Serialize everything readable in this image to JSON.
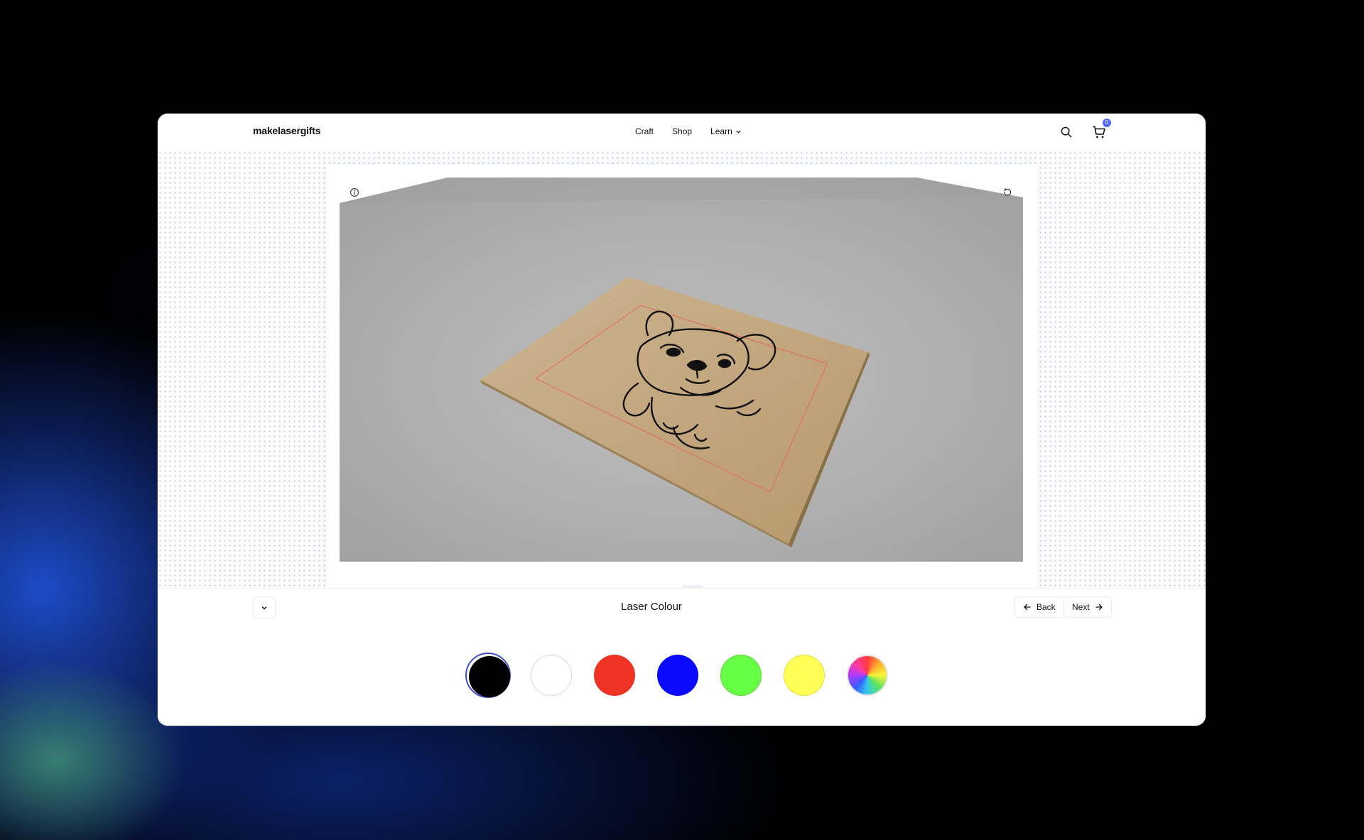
{
  "app": {
    "logo": "makelasergifts",
    "nav": [
      {
        "label": "Craft"
      },
      {
        "label": "Shop"
      },
      {
        "label": "Learn",
        "has_dropdown": true
      }
    ],
    "cart_count": "0"
  },
  "viewer": {
    "info_icon": "info-icon",
    "reset_icon": "rotate-ccw-icon",
    "board_material": "wood",
    "engraving": "french-bulldog-sketch"
  },
  "step": {
    "title": "Laser Colour",
    "back_label": "Back",
    "next_label": "Next"
  },
  "laser_colours": [
    {
      "name": "black",
      "color": "#000000",
      "selected": true
    },
    {
      "name": "white",
      "color": "#ffffff",
      "selected": false
    },
    {
      "name": "red",
      "color": "#ee3224",
      "selected": false
    },
    {
      "name": "blue",
      "color": "#0a0aff",
      "selected": false
    },
    {
      "name": "green",
      "color": "#66ff44",
      "selected": false
    },
    {
      "name": "yellow",
      "color": "#ffff55",
      "selected": false
    },
    {
      "name": "custom",
      "color": "conic-gradient",
      "selected": false
    }
  ]
}
